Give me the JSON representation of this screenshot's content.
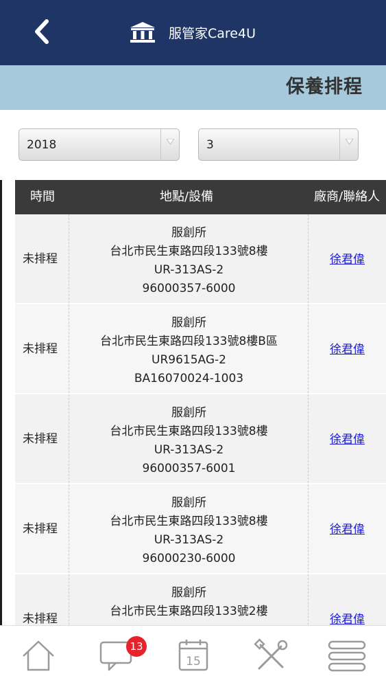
{
  "header": {
    "app_title": "服管家Care4U"
  },
  "page": {
    "title": "保養排程"
  },
  "filters": {
    "year": "2018",
    "month": "3"
  },
  "table": {
    "headers": {
      "time": "時間",
      "location": "地點/設備",
      "vendor": "廠商/聯絡人"
    },
    "rows": [
      {
        "time": "未排程",
        "place": "服創所",
        "address": "台北市民生東路四段133號8樓",
        "model": "UR-313AS-2",
        "serial": "96000357-6000",
        "contact": "徐君偉"
      },
      {
        "time": "未排程",
        "place": "服創所",
        "address": "台北市民生東路四段133號8樓B區",
        "model": "UR9615AG-2",
        "serial": "BA16070024-1003",
        "contact": "徐君偉"
      },
      {
        "time": "未排程",
        "place": "服創所",
        "address": "台北市民生東路四段133號8樓",
        "model": "UR-313AS-2",
        "serial": "96000357-6001",
        "contact": "徐君偉"
      },
      {
        "time": "未排程",
        "place": "服創所",
        "address": "台北市民生東路四段133號8樓",
        "model": "UR-313AS-2",
        "serial": "96000230-6000",
        "contact": "徐君偉"
      },
      {
        "time": "未排程",
        "place": "服創所",
        "address": "台北市民生東路四段133號2樓",
        "model": "",
        "serial": "",
        "contact": "徐君偉"
      }
    ]
  },
  "tabbar": {
    "messages_badge": "13",
    "calendar_day": "15",
    "icons": [
      "home-icon",
      "chat-icon",
      "calendar-icon",
      "tools-icon",
      "menu-icon"
    ]
  },
  "colors": {
    "header_bg": "#1f3566",
    "title_band": "#a6c9dc",
    "badge": "#e8222a",
    "link": "#1a1ad6"
  }
}
